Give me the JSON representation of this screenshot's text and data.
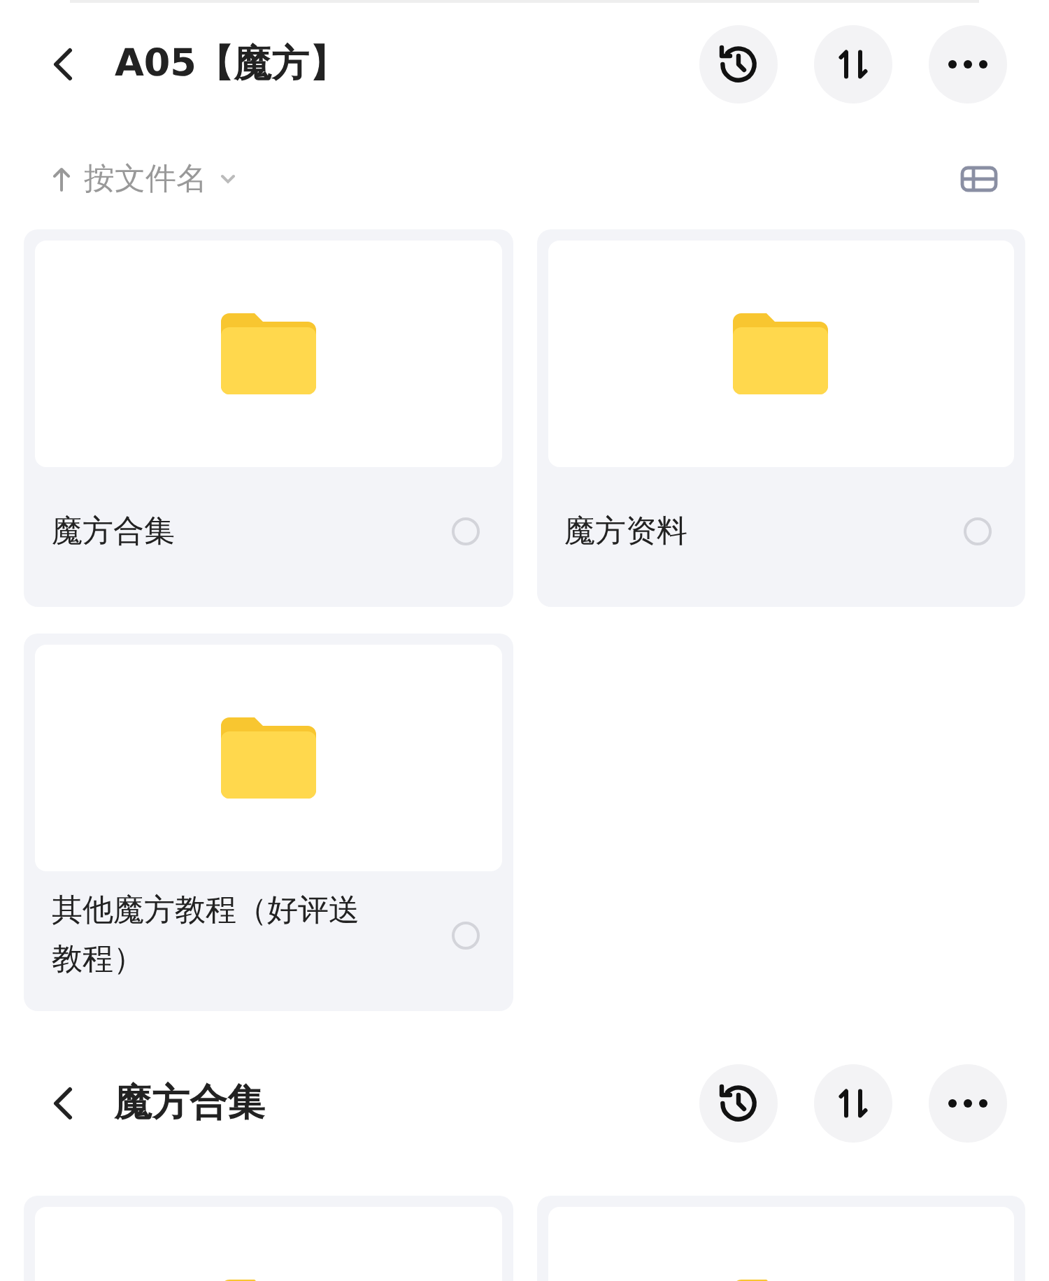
{
  "sections": [
    {
      "title": "A05【魔方】",
      "sort": {
        "label": "按文件名"
      },
      "items": [
        {
          "kind": "folder",
          "name": "魔方合集",
          "selected": false
        },
        {
          "kind": "folder",
          "name": "魔方资料",
          "selected": false
        },
        {
          "kind": "folder",
          "name": "其他魔方教程（好评送教程）",
          "selected": false
        }
      ]
    },
    {
      "title": "魔方合集",
      "items": [
        {
          "kind": "folder"
        },
        {
          "kind": "folder"
        }
      ]
    }
  ]
}
